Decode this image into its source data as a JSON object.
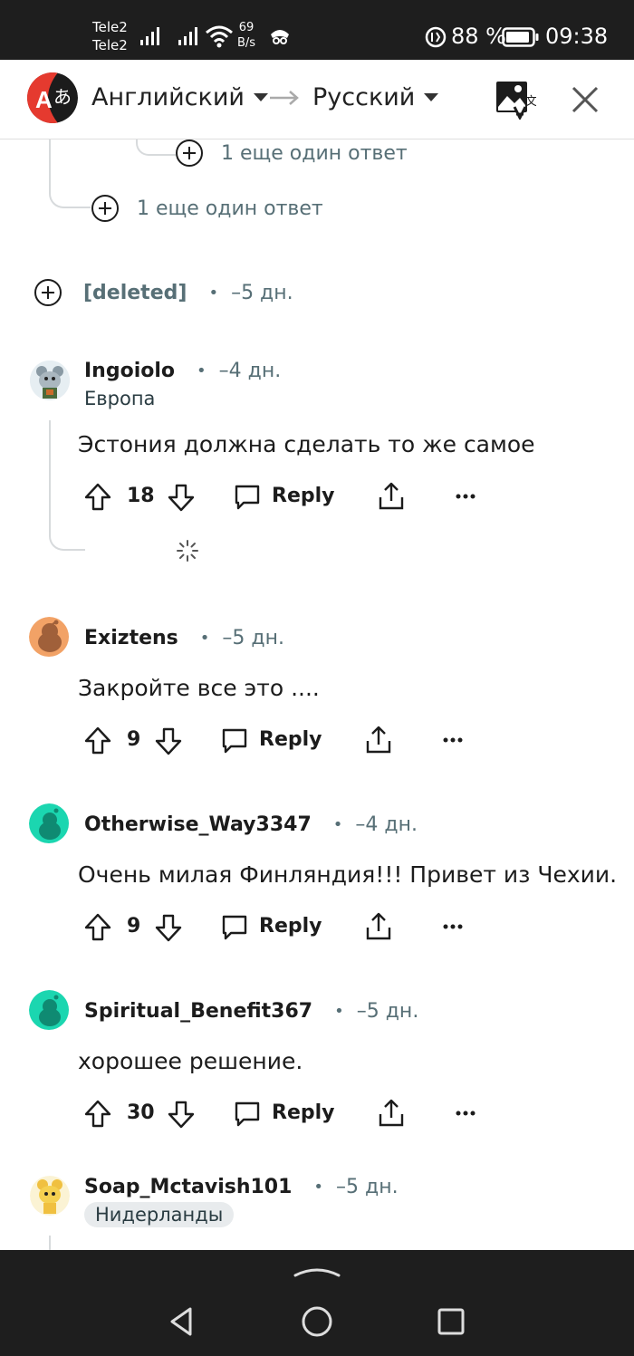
{
  "status_bar": {
    "carrier1": "Tele2",
    "carrier2": "Tele2",
    "net_speed_value": "69",
    "net_speed_unit": "B/s",
    "battery": "88 %",
    "time": "09:38"
  },
  "translate_bar": {
    "source_lang": "Английский",
    "target_lang": "Русский",
    "icons": [
      "translate-logo-icon",
      "swap-arrow-icon",
      "image-translate-icon",
      "close-icon"
    ]
  },
  "thread": {
    "more_replies_nested": "1 еще один ответ",
    "more_replies": "1 еще один ответ"
  },
  "comments": [
    {
      "username": "[deleted]",
      "age": "–5 дн."
    },
    {
      "username": "Ingoiolo",
      "age": "–4 дн.",
      "flair": "Европа",
      "body": "Эстония должна сделать то же самое",
      "votes": "18",
      "reply": "Reply"
    },
    {
      "username": "Exiztens",
      "age": "–5 дн.",
      "body": "Закройте все это ....",
      "votes": "9",
      "reply": "Reply"
    },
    {
      "username": "Otherwise_Way3347",
      "age": "–4 дн.",
      "body": "Очень милая Финляндия!!! Привет из Чехии.",
      "votes": "9",
      "reply": "Reply"
    },
    {
      "username": "Spiritual_Benefit367",
      "age": "–5 дн.",
      "body": "хорошее решение.",
      "votes": "30",
      "reply": "Reply"
    },
    {
      "username": "Soap_Mctavish101",
      "age": "–5 дн.",
      "flair": "Нидерланды"
    }
  ],
  "colors": {
    "meta_gray": "#576f76",
    "thread_line": "#d7dadc",
    "system_bar": "#1e1e1e",
    "translate_red": "#e53a2f"
  }
}
